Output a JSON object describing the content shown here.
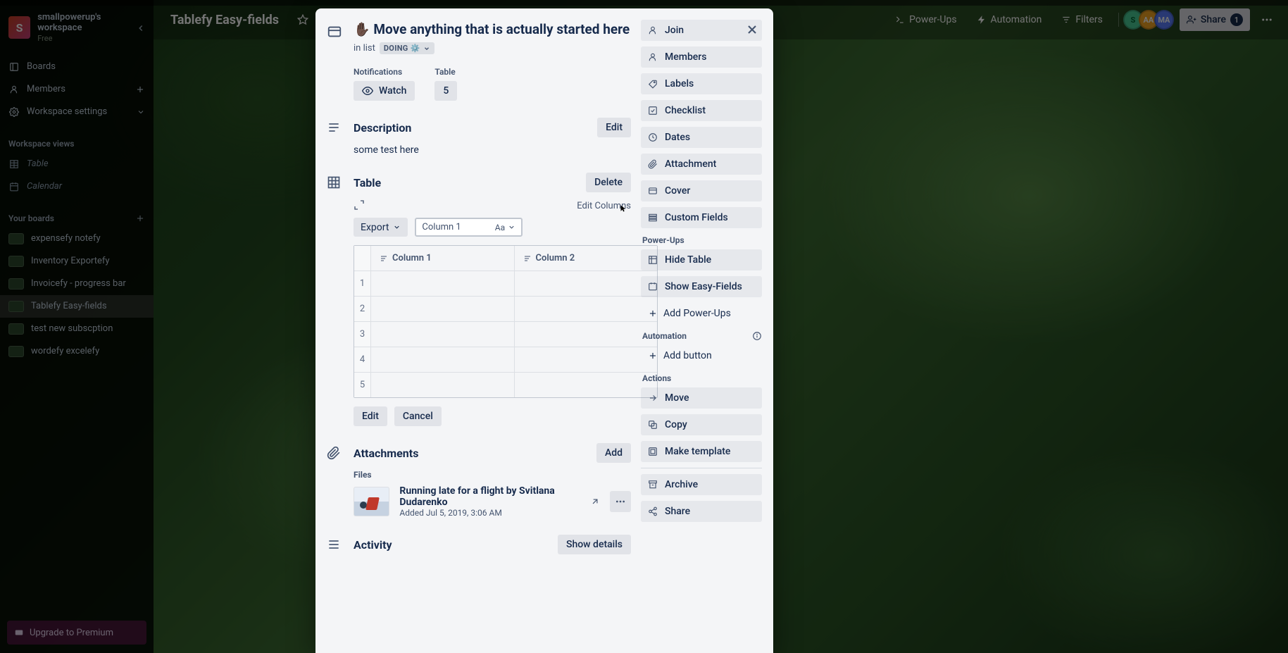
{
  "workspace": {
    "avatar_letter": "S",
    "name": "smallpowerup's workspace",
    "plan": "Free"
  },
  "sidebar": {
    "nav": {
      "boards": "Boards",
      "members": "Members",
      "settings": "Workspace settings"
    },
    "views_heading": "Workspace views",
    "views": {
      "table": "Table",
      "calendar": "Calendar"
    },
    "boards_heading": "Your boards",
    "boards": [
      {
        "label": "expensefy notefy"
      },
      {
        "label": "Inventory Exportefy"
      },
      {
        "label": "Invoicefy - progress bar"
      },
      {
        "label": "Tablefy Easy-fields"
      },
      {
        "label": "test new subscption"
      },
      {
        "label": "wordefy excelefy"
      }
    ],
    "upgrade": "Upgrade to Premium"
  },
  "board_header": {
    "name": "Tablefy Easy-fields",
    "powerups": "Power-Ups",
    "automation": "Automation",
    "filters": "Filters",
    "share": "Share",
    "share_count": "1",
    "avatars": [
      "S",
      "AA",
      "MA"
    ]
  },
  "card": {
    "title": "✋🏿 Move anything that is actually started here",
    "in_list_prefix": "in list",
    "list_name": "DOING ⚙️",
    "notifications_label": "Notifications",
    "watch": "Watch",
    "table_count_label": "Table",
    "table_count": "5",
    "description_heading": "Description",
    "description_edit": "Edit",
    "description_text": "some test here",
    "table_heading": "Table",
    "table_delete": "Delete",
    "table_edit_columns": "Edit Columns",
    "export": "Export",
    "column_select": "Column 1",
    "column_type": "Aa",
    "columns": [
      "Column 1",
      "Column 2"
    ],
    "rows": [
      "1",
      "2",
      "3",
      "4",
      "5"
    ],
    "edit_btn": "Edit",
    "cancel_btn": "Cancel",
    "attachments_heading": "Attachments",
    "attachments_add": "Add",
    "files_label": "Files",
    "attachment": {
      "name": "Running late for a flight by Svitlana Dudarenko",
      "added": "Added Jul 5, 2019, 3:06 AM"
    },
    "activity_heading": "Activity",
    "activity_toggle": "Show details"
  },
  "card_side": {
    "join": "Join",
    "members": "Members",
    "labels": "Labels",
    "checklist": "Checklist",
    "dates": "Dates",
    "attachment": "Attachment",
    "cover": "Cover",
    "custom_fields": "Custom Fields",
    "powerups_heading": "Power-Ups",
    "hide_table": "Hide Table",
    "show_easy": "Show Easy-Fields",
    "add_powerups": "Add Power-Ups",
    "automation_heading": "Automation",
    "add_button": "Add button",
    "actions_heading": "Actions",
    "move": "Move",
    "copy": "Copy",
    "template": "Make template",
    "archive": "Archive",
    "share": "Share"
  }
}
